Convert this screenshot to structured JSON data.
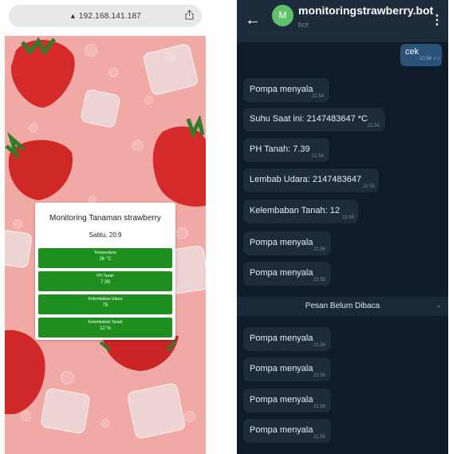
{
  "browser": {
    "url": "192.168.141.187",
    "card": {
      "title": "Monitoring Tanaman strawberry",
      "time": "Sabtu, 20:9",
      "sensors": [
        {
          "label": "Temperature",
          "value": "26 °C"
        },
        {
          "label": "PH Tanah",
          "value": "7.39"
        },
        {
          "label": "Kelembaban Udara",
          "value": "75"
        },
        {
          "label": "Kelembaban Tanah",
          "value": "12 %"
        }
      ]
    }
  },
  "telegram": {
    "header": {
      "avatar_letter": "M",
      "title": "monitoringstrawberry.bot",
      "subtitle": "bot"
    },
    "outgoing": {
      "text": "cek",
      "time": "22.54"
    },
    "messages": [
      {
        "text": "Pompa menyala",
        "time": "22.54"
      },
      {
        "text": "Suhu Saat ini: 2147483647 *C",
        "time": "22.54"
      },
      {
        "text": "PH Tanah: 7.39",
        "time": "22.54"
      },
      {
        "text": "Lembab Udara: 2147483647",
        "time": "22.55"
      },
      {
        "text": "Kelembaban Tanah: 12",
        "time": "22.55"
      },
      {
        "text": "Pompa menyala",
        "time": "22.55"
      },
      {
        "text": "Pompa menyala",
        "time": "22.55"
      }
    ],
    "unread_label": "Pesan Belum Dibaca",
    "messages_after": [
      {
        "text": "Pompa menyala",
        "time": "22.55"
      },
      {
        "text": "Pompa menyala",
        "time": "22.56"
      },
      {
        "text": "Pompa menyala",
        "time": "22.56"
      },
      {
        "text": "Pompa menyala",
        "time": "22.56"
      }
    ]
  }
}
